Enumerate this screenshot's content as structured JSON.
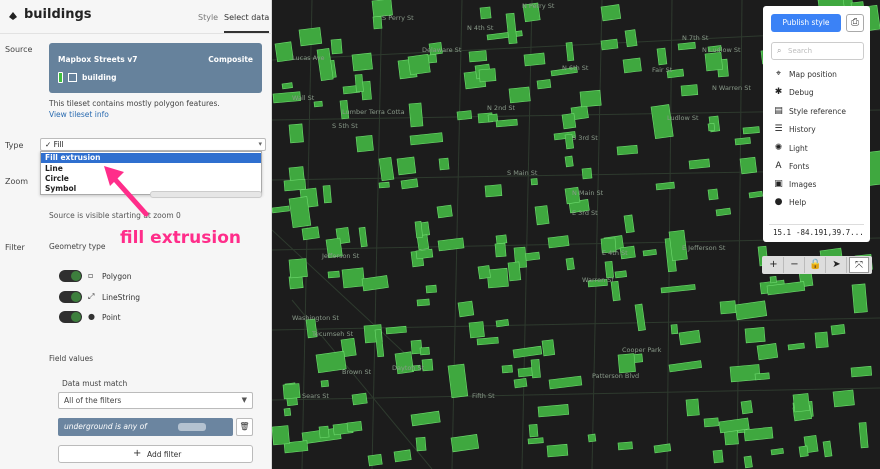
{
  "header": {
    "layer_title": "buildings",
    "tab_style": "Style",
    "tab_select_data": "Select data"
  },
  "source": {
    "label": "Source",
    "name": "Mapbox Streets v7",
    "type": "Composite",
    "layer": "building",
    "description": "This tileset contains mostly polygon features.",
    "info_link": "View tileset info",
    "layer_color": "#3fbf3f"
  },
  "type": {
    "label": "Type",
    "selected": "Fill",
    "options": [
      "Fill extrusion",
      "Line",
      "Circle",
      "Symbol"
    ],
    "highlight_color": "#2f6fcf"
  },
  "zoom": {
    "label": "Zoom",
    "note": "Source is visible starting at zoom 0"
  },
  "annotation": {
    "text": "fill extrusion",
    "color": "#ff2d8a"
  },
  "filter": {
    "label": "Filter",
    "geometry_title": "Geometry type",
    "geometry": [
      {
        "label": "Polygon",
        "icon": "polygon-icon",
        "enabled": true
      },
      {
        "label": "LineString",
        "icon": "linestring-icon",
        "enabled": true
      },
      {
        "label": "Point",
        "icon": "point-icon",
        "enabled": true
      }
    ],
    "field_values_title": "Field values",
    "match_label": "Data must match",
    "match_value": "All of the filters",
    "chip_text": "underground is any of",
    "add_filter": "Add filter"
  },
  "map": {
    "building_color": "#3fa83f",
    "background": "#1c1c1c",
    "street_labels": [
      "N Perry St",
      "S Perry St",
      "Lucas Ave",
      "Delaware St",
      "Wall St",
      "N 4th St",
      "N 7th St",
      "N 6th St",
      "N 2nd St",
      "S 5th St",
      "S 3rd St",
      "Lumber Terra Cotta",
      "Ludlow St",
      "N Ludlow St",
      "Fair St",
      "Jefferson St",
      "E Jefferson St",
      "S Main St",
      "N Main St",
      "E 3rd St",
      "E 4th St",
      "Warren St",
      "N Warren St",
      "Washington St",
      "Dayton St",
      "Cooper Park",
      "Patterson Blvd",
      "Brown St",
      "Sears St",
      "Tecumseh St",
      "Fifth St"
    ]
  },
  "toolbar": {
    "publish": "Publish style",
    "search_placeholder": "Search",
    "items": [
      {
        "label": "Map position",
        "icon": "crosshair-icon"
      },
      {
        "label": "Debug",
        "icon": "bug-icon"
      },
      {
        "label": "Style reference",
        "icon": "book-icon"
      },
      {
        "label": "History",
        "icon": "history-icon"
      },
      {
        "label": "Light",
        "icon": "light-icon"
      },
      {
        "label": "Fonts",
        "icon": "fonts-icon"
      },
      {
        "label": "Images",
        "icon": "images-icon"
      },
      {
        "label": "Help",
        "icon": "help-icon"
      }
    ],
    "zoom": "15.1",
    "coords": "-84.191,39.7..."
  },
  "map_controls": [
    "+",
    "−",
    "lock",
    "compass",
    "fullscreen"
  ]
}
